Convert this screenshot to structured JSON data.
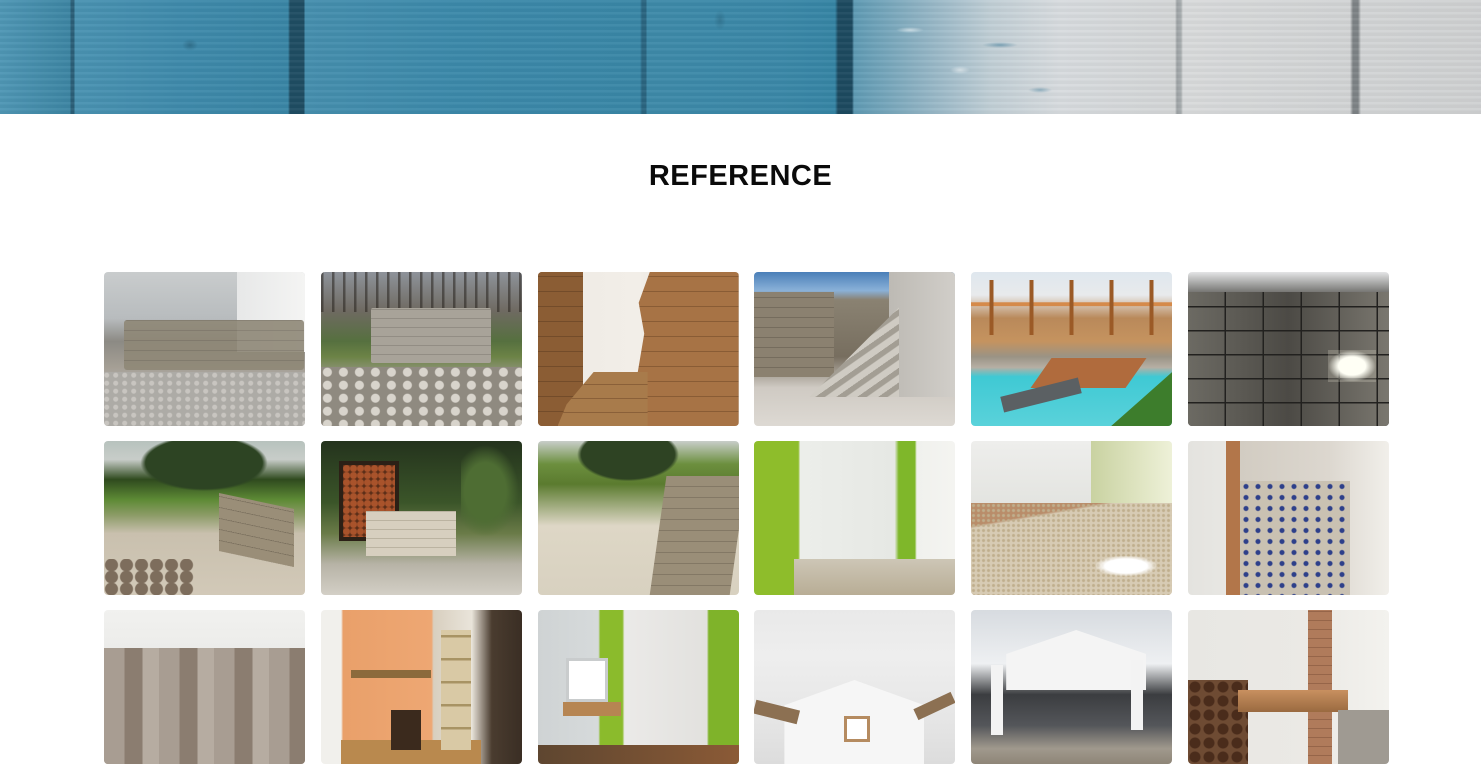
{
  "hero": {
    "description_icon": "painted-wood-banner"
  },
  "section": {
    "title": "REFERENCE"
  },
  "gallery": {
    "tiles": [
      {
        "icon": "stone-wall-photo"
      },
      {
        "icon": "stone-wall-hillside-photo"
      },
      {
        "icon": "brick-cladding-interior-photo"
      },
      {
        "icon": "stone-staircase-photo"
      },
      {
        "icon": "pool-pergola-photo"
      },
      {
        "icon": "tiled-floor-photo"
      },
      {
        "icon": "garden-wall-tree-photo"
      },
      {
        "icon": "firewood-shed-photo"
      },
      {
        "icon": "wall-gravel-photo"
      },
      {
        "icon": "green-wall-room-photo"
      },
      {
        "icon": "empty-room-floor-photo"
      },
      {
        "icon": "tile-laying-photo"
      },
      {
        "icon": "patterned-tile-floor-photo"
      },
      {
        "icon": "orange-room-furniture-photo"
      },
      {
        "icon": "green-wall-window-photo"
      },
      {
        "icon": "attic-room-photo"
      },
      {
        "icon": "attic-construction-photo"
      },
      {
        "icon": "workshop-brick-column-photo"
      }
    ]
  }
}
